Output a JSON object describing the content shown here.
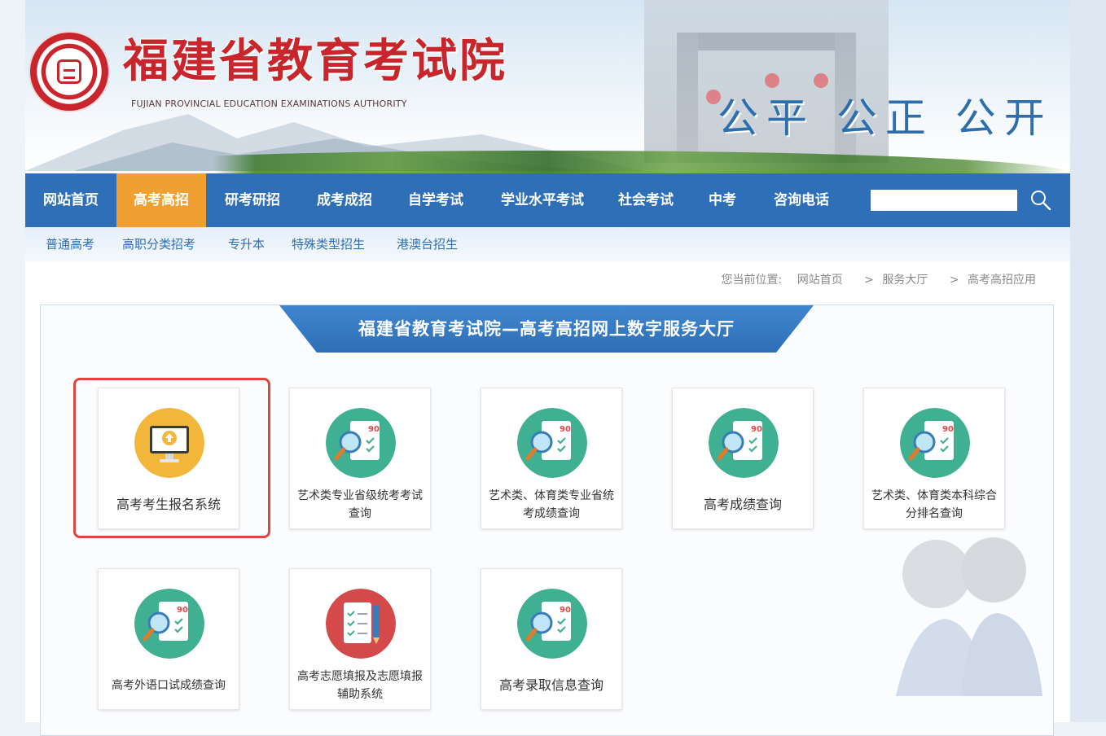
{
  "header": {
    "title_cn": "福建省教育考试院",
    "title_en": "FUJIAN PROVINCIAL EDUCATION EXAMINATIONS AUTHORITY",
    "slogan": "公平 公正 公开"
  },
  "nav": {
    "items": [
      "网站首页",
      "高考高招",
      "研考研招",
      "成考成招",
      "自学考试",
      "学业水平考试",
      "社会考试",
      "中考",
      "咨询电话"
    ],
    "active_index": 1,
    "search_value": ""
  },
  "subnav": {
    "items": [
      "普通高考",
      "高职分类招考",
      "专升本",
      "特殊类型招生",
      "港澳台招生"
    ]
  },
  "breadcrumb": {
    "prefix": "您当前位置:",
    "items": [
      "网站首页",
      "服务大厅",
      "高考高招应用"
    ],
    "separator": ">"
  },
  "hall": {
    "title": "福建省教育考试院—高考高招网上数字服务大厅",
    "cards": [
      {
        "label": "高考考生报名系统",
        "icon": "monitor-upload-icon",
        "highlighted": true
      },
      {
        "label": "艺术类专业省级统考考试查询",
        "icon": "score-search-icon"
      },
      {
        "label": "艺术类、体育类专业省统考成绩查询",
        "icon": "score-search-icon"
      },
      {
        "label": "高考成绩查询",
        "icon": "score-search-icon"
      },
      {
        "label": "艺术类、体育类本科综合分排名查询",
        "icon": "score-search-icon"
      },
      {
        "label": "高考外语口试成绩查询",
        "icon": "score-search-icon"
      },
      {
        "label": "高考志愿填报及志愿填报辅助系统",
        "icon": "form-pencil-icon"
      },
      {
        "label": "高考录取信息查询",
        "icon": "score-search-icon"
      }
    ]
  },
  "colors": {
    "nav_blue": "#2e6fb7",
    "nav_active": "#f0a032",
    "brand_red": "#c8262c",
    "icon_green": "#3fb092",
    "icon_yellow": "#f2b63a",
    "icon_red": "#d44a4a",
    "highlight_red": "#e0463c"
  }
}
